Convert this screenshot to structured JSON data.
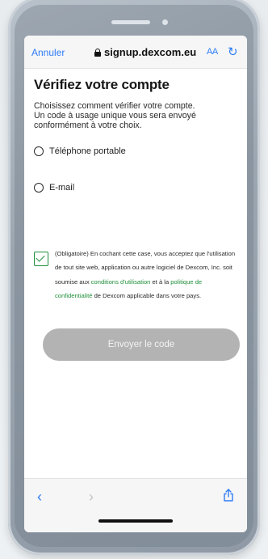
{
  "browser": {
    "cancel_label": "Annuler",
    "url": "signup.dexcom.eu",
    "text_size_label": "AA",
    "reload_icon": "reload-icon"
  },
  "page": {
    "title": "Vérifiez votre compte",
    "intro_line1": "Choisissez comment vérifier votre compte.",
    "intro_line2": "Un code à usage unique vous sera envoyé",
    "intro_line3": "conformément à votre choix."
  },
  "options": [
    {
      "label": "Téléphone portable",
      "selected": false
    },
    {
      "label": "E-mail",
      "selected": false
    }
  ],
  "consent": {
    "checked": true,
    "text_before": "(Obligatoire) En cochant cette case, vous acceptez que l'utilisation de tout site web, application ou autre logiciel de Dexcom, Inc. soit soumise aux ",
    "link_terms": "conditions d'utilisation",
    "text_mid": " et à la ",
    "link_privacy": "politique de confidentialité",
    "text_after": " de Dexcom applicable dans votre pays.",
    "accent_color": "#1f8f3a"
  },
  "submit": {
    "label": "Envoyer le code",
    "enabled": false
  },
  "toolbar": {
    "back_icon": "chevron-left-icon",
    "forward_icon": "chevron-right-icon",
    "share_icon": "share-icon"
  }
}
